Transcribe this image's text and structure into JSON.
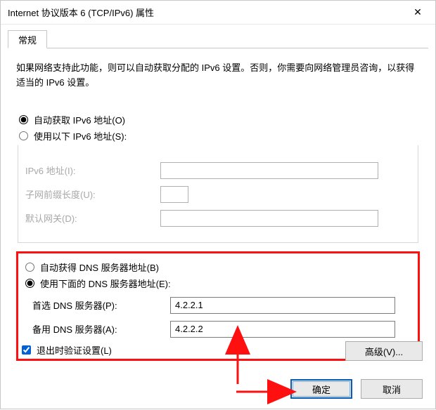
{
  "window": {
    "title": "Internet 协议版本 6 (TCP/IPv6) 属性"
  },
  "tabs": {
    "general": "常规"
  },
  "intro": "如果网络支持此功能，则可以自动获取分配的 IPv6 设置。否则，你需要向网络管理员咨询，以获得适当的 IPv6 设置。",
  "ip_section": {
    "auto_label": "自动获取 IPv6 地址(O)",
    "manual_label": "使用以下 IPv6 地址(S):",
    "selected": "auto",
    "addr_label": "IPv6 地址(I):",
    "addr_value": "",
    "prefix_label": "子网前缀长度(U):",
    "prefix_value": "",
    "gateway_label": "默认网关(D):",
    "gateway_value": ""
  },
  "dns_section": {
    "auto_label": "自动获得 DNS 服务器地址(B)",
    "manual_label": "使用下面的 DNS 服务器地址(E):",
    "selected": "manual",
    "preferred_label": "首选 DNS 服务器(P):",
    "preferred_value": "4.2.2.1",
    "alternate_label": "备用 DNS 服务器(A):",
    "alternate_value": "4.2.2.2"
  },
  "validate": {
    "label": "退出时验证设置(L)",
    "checked": true
  },
  "buttons": {
    "advanced": "高级(V)...",
    "ok": "确定",
    "cancel": "取消"
  }
}
